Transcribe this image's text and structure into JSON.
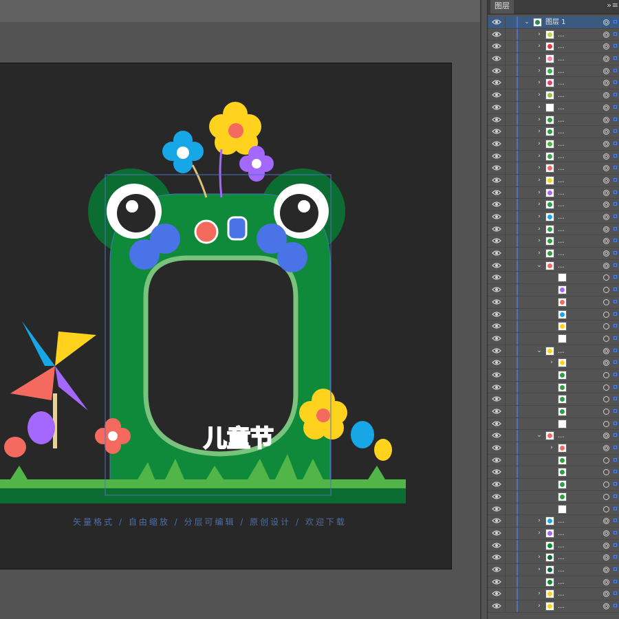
{
  "panel": {
    "tab_label": "图层",
    "collapse_icon": "»",
    "menu_icon": "≡",
    "top_layer_name": "图层 1",
    "collapsed_name": "..."
  },
  "artboard": {
    "title_text": "儿童节",
    "footer_text": "矢量格式 / 自由缩放 / 分层可编辑 / 原创设计 / 欢迎下载"
  },
  "colors": {
    "accent_blue": "#4b73c0",
    "frame_green": "#0f8a3a",
    "dark_green": "#0c6d32",
    "yellow": "#ffd21e",
    "blue": "#18a7e6",
    "purple": "#a468ff",
    "coral": "#f46a5e"
  },
  "layers": [
    {
      "indent": 0,
      "arrow": "open",
      "thumb": "#2e8b57",
      "selected": true,
      "target": "dbl"
    },
    {
      "indent": 1,
      "arrow": "closed",
      "thumb": "#b9d84a",
      "target": "dbl"
    },
    {
      "indent": 1,
      "arrow": "closed",
      "thumb": "#e23b3b",
      "target": "dbl"
    },
    {
      "indent": 1,
      "arrow": "closed",
      "thumb": "#ff7fae",
      "target": "dbl"
    },
    {
      "indent": 1,
      "arrow": "closed",
      "thumb": "#3cb04a",
      "target": "dbl"
    },
    {
      "indent": 1,
      "arrow": "closed",
      "thumb": "#e9405f",
      "target": "dbl"
    },
    {
      "indent": 1,
      "arrow": "closed",
      "thumb": "#93c54b",
      "target": "dbl"
    },
    {
      "indent": 1,
      "arrow": "closed",
      "thumb": "#ffffff",
      "target": "dbl"
    },
    {
      "indent": 1,
      "arrow": "closed",
      "thumb": "#2f9e44",
      "target": "dbl"
    },
    {
      "indent": 1,
      "arrow": "closed",
      "thumb": "#2f9e44",
      "target": "dbl"
    },
    {
      "indent": 1,
      "arrow": "closed",
      "thumb": "#52b547",
      "target": "dbl"
    },
    {
      "indent": 1,
      "arrow": "closed",
      "thumb": "#3aa64b",
      "target": "dbl"
    },
    {
      "indent": 1,
      "arrow": "closed",
      "thumb": "#f46a5e",
      "target": "dbl"
    },
    {
      "indent": 1,
      "arrow": "closed",
      "thumb": "#ffd21e",
      "target": "dbl"
    },
    {
      "indent": 1,
      "arrow": "closed",
      "thumb": "#a468ff",
      "target": "dbl"
    },
    {
      "indent": 1,
      "arrow": "closed",
      "thumb": "#2f9e44",
      "target": "dbl"
    },
    {
      "indent": 1,
      "arrow": "closed",
      "thumb": "#18a7e6",
      "target": "dbl"
    },
    {
      "indent": 1,
      "arrow": "closed",
      "thumb": "#2f9e44",
      "target": "dbl"
    },
    {
      "indent": 1,
      "arrow": "closed",
      "thumb": "#2f9e44",
      "target": "dbl"
    },
    {
      "indent": 1,
      "arrow": "closed",
      "thumb": "#2f9e44",
      "target": "dbl"
    },
    {
      "indent": 1,
      "arrow": "open",
      "thumb": "#f46a5e",
      "target": "dbl"
    },
    {
      "indent": 2,
      "arrow": "none",
      "thumb": "#ffffff",
      "target": "single"
    },
    {
      "indent": 2,
      "arrow": "none",
      "thumb": "#a468ff",
      "target": "single"
    },
    {
      "indent": 2,
      "arrow": "none",
      "thumb": "#f46a5e",
      "target": "single"
    },
    {
      "indent": 2,
      "arrow": "none",
      "thumb": "#18a7e6",
      "target": "single"
    },
    {
      "indent": 2,
      "arrow": "none",
      "thumb": "#ffd21e",
      "target": "single"
    },
    {
      "indent": 2,
      "arrow": "none",
      "thumb": "#ffffff",
      "target": "single"
    },
    {
      "indent": 1,
      "arrow": "open",
      "thumb": "#ffd21e",
      "target": "dbl"
    },
    {
      "indent": 2,
      "arrow": "closed",
      "thumb": "#ffd21e",
      "target": "dbl"
    },
    {
      "indent": 2,
      "arrow": "none",
      "thumb": "#2f9e44",
      "target": "single"
    },
    {
      "indent": 2,
      "arrow": "none",
      "thumb": "#2f9e44",
      "target": "single"
    },
    {
      "indent": 2,
      "arrow": "none",
      "thumb": "#2f9e44",
      "target": "single"
    },
    {
      "indent": 2,
      "arrow": "none",
      "thumb": "#2f9e44",
      "target": "single"
    },
    {
      "indent": 2,
      "arrow": "none",
      "thumb": "#ffffff",
      "target": "single"
    },
    {
      "indent": 1,
      "arrow": "open",
      "thumb": "#f46a5e",
      "target": "dbl"
    },
    {
      "indent": 2,
      "arrow": "closed",
      "thumb": "#f46a5e",
      "target": "dbl"
    },
    {
      "indent": 2,
      "arrow": "none",
      "thumb": "#2f9e44",
      "target": "single"
    },
    {
      "indent": 2,
      "arrow": "none",
      "thumb": "#2f9e44",
      "target": "single"
    },
    {
      "indent": 2,
      "arrow": "none",
      "thumb": "#2f9e44",
      "target": "single"
    },
    {
      "indent": 2,
      "arrow": "none",
      "thumb": "#2f9e44",
      "target": "single"
    },
    {
      "indent": 2,
      "arrow": "none",
      "thumb": "#ffffff",
      "target": "single"
    },
    {
      "indent": 1,
      "arrow": "closed",
      "thumb": "#18a7e6",
      "target": "dbl"
    },
    {
      "indent": 1,
      "arrow": "closed",
      "thumb": "#a468ff",
      "target": "dbl"
    },
    {
      "indent": 1,
      "arrow": "none",
      "thumb": "#0f8a3a",
      "target": "dbl"
    },
    {
      "indent": 1,
      "arrow": "closed",
      "thumb": "#0c6d32",
      "target": "dbl"
    },
    {
      "indent": 1,
      "arrow": "closed",
      "thumb": "#0c6d32",
      "target": "dbl"
    },
    {
      "indent": 1,
      "arrow": "none",
      "thumb": "#0f8a3a",
      "target": "dbl"
    },
    {
      "indent": 1,
      "arrow": "closed",
      "thumb": "#ffd21e",
      "target": "dbl"
    },
    {
      "indent": 1,
      "arrow": "closed",
      "thumb": "#ffd21e",
      "target": "dbl"
    }
  ]
}
